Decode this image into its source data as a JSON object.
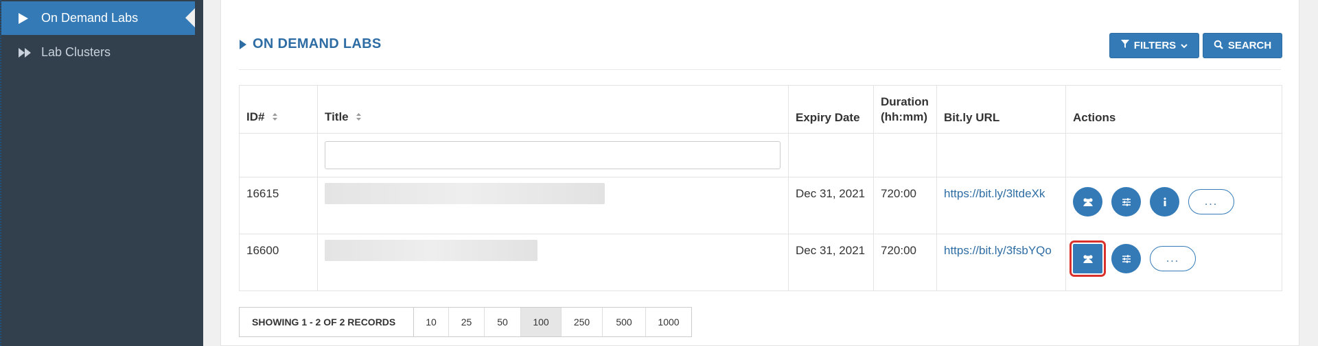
{
  "sidebar": {
    "items": [
      {
        "label": "On Demand Labs",
        "icon": "play-icon",
        "active": true
      },
      {
        "label": "Lab Clusters",
        "icon": "fast-forward-icon",
        "active": false
      }
    ]
  },
  "header": {
    "title": "ON DEMAND LABS",
    "filters_label": "FILTERS",
    "search_label": "SEARCH"
  },
  "table": {
    "columns": [
      "ID#",
      "Title",
      "Expiry Date",
      "Duration (hh:mm)",
      "Bit.ly URL",
      "Actions"
    ],
    "title_filter_value": "",
    "rows": [
      {
        "id": "16615",
        "title": "",
        "expiry": "Dec 31, 2021",
        "duration": "720:00",
        "url": "https://bit.ly/3ltdeXk"
      },
      {
        "id": "16600",
        "title": "",
        "expiry": "Dec 31, 2021",
        "duration": "720:00",
        "url": "https://bit.ly/3fsbYQo"
      }
    ],
    "more_label": "..."
  },
  "pager": {
    "summary": "SHOWING 1 - 2 OF 2 RECORDS",
    "sizes": [
      "10",
      "25",
      "50",
      "100",
      "250",
      "500",
      "1000"
    ],
    "active": "100"
  },
  "colors": {
    "accent": "#337ab7",
    "sidebar": "#323f4d",
    "highlight": "#d9302c"
  }
}
